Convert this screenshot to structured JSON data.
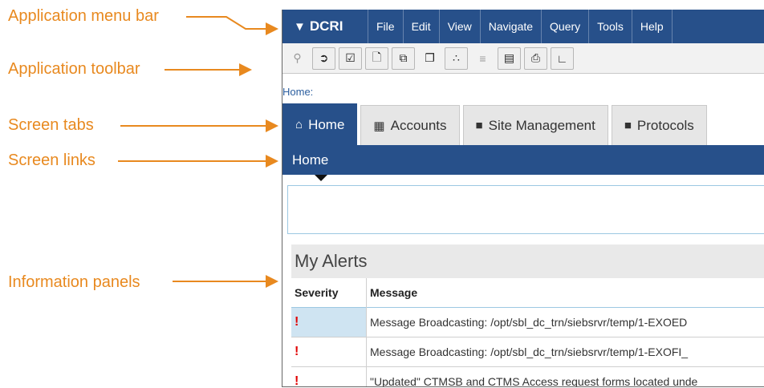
{
  "annotations": {
    "menu_bar": "Application menu bar",
    "toolbar": "Application toolbar",
    "screen_tabs": "Screen tabs",
    "screen_links": "Screen links",
    "info_panels": "Information panels"
  },
  "app": {
    "brand": "DCRI",
    "menu": [
      "File",
      "Edit",
      "View",
      "Navigate",
      "Query",
      "Tools",
      "Help"
    ],
    "toolbar_icons": [
      "search-icon",
      "go-icon",
      "checklist-icon",
      "new-record-icon",
      "copy-record-icon",
      "paste-icon",
      "network-icon",
      "list-icon",
      "clipboard-icon",
      "print-icon",
      "chart-icon"
    ],
    "breadcrumb": "Home:",
    "tabs": [
      "Home",
      "Accounts",
      "Site Management",
      "Protocols"
    ],
    "screen_link": "Home",
    "alerts": {
      "title": "My Alerts",
      "columns": [
        "Severity",
        "Message"
      ],
      "rows": [
        {
          "severity": "!",
          "message": "Message Broadcasting: /opt/sbl_dc_trn/siebsrvr/temp/1-EXOED"
        },
        {
          "severity": "!",
          "message": "Message Broadcasting: /opt/sbl_dc_trn/siebsrvr/temp/1-EXOFI_"
        },
        {
          "severity": "!",
          "message": "\"Updated\" CTMSB and CTMS Access request forms located unde"
        }
      ]
    }
  },
  "colors": {
    "accent": "#27508a",
    "annotation": "#e8891f",
    "alert": "#e00000"
  }
}
